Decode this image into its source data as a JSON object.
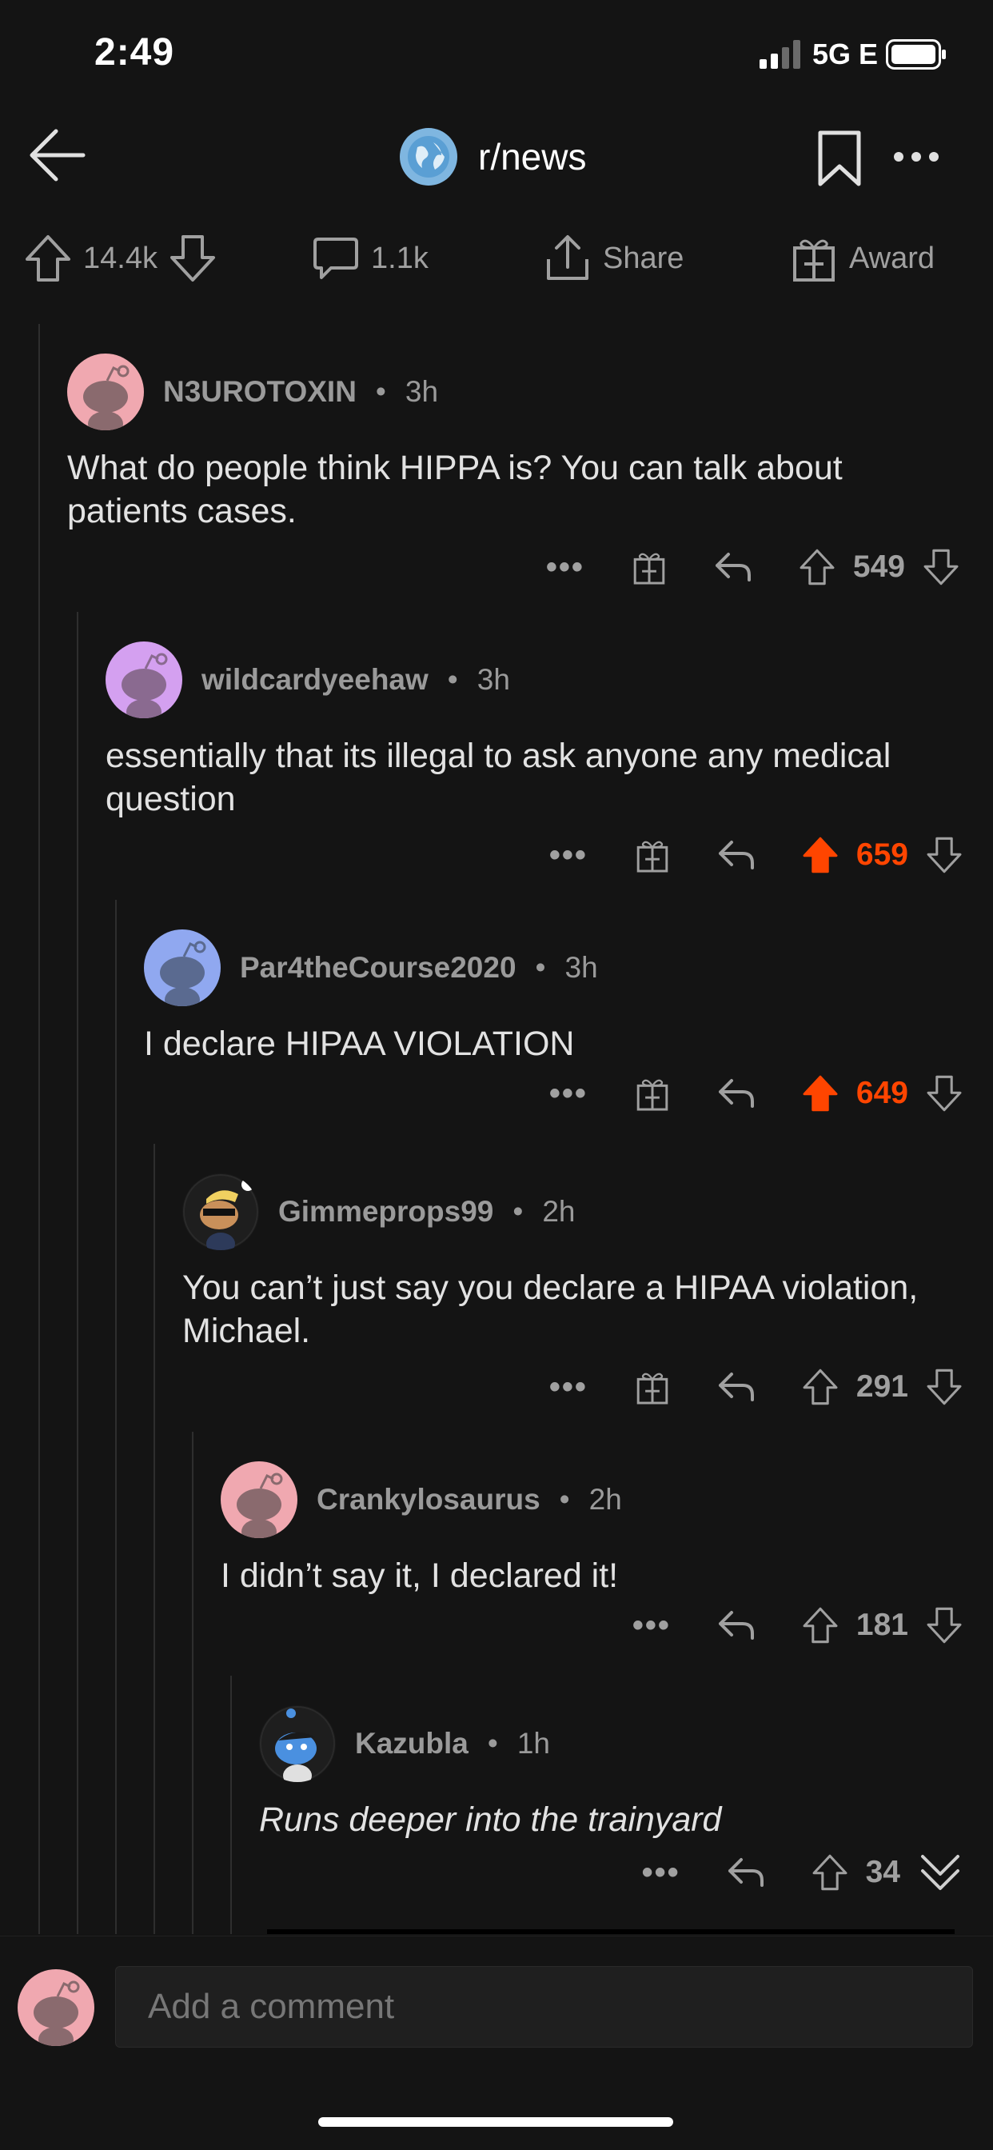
{
  "status_bar": {
    "time": "2:49",
    "network": "5G E"
  },
  "nav": {
    "subreddit": "r/news",
    "back_icon": "back-arrow-icon",
    "bookmark_icon": "bookmark-icon",
    "more_icon": "more-horizontal-icon"
  },
  "post_actions": {
    "upvotes": "14.4k",
    "comments": "1.1k",
    "share": "Share",
    "award": "Award"
  },
  "comments": [
    {
      "username": "N3UROTOXIN",
      "age": "3h",
      "body": "What do people think HIPPA is? You can talk about patients cases.",
      "score": "549",
      "upvoted": false,
      "avatar_color": "#f0a8b0"
    },
    {
      "username": "wildcardyeehaw",
      "age": "3h",
      "body": "essentially that its illegal to ask anyone any medical question",
      "score": "659",
      "upvoted": true,
      "avatar_color": "#d4a0f0"
    },
    {
      "username": "Par4theCourse2020",
      "age": "3h",
      "body": "I declare HIPAA VIOLATION",
      "score": "649",
      "upvoted": true,
      "avatar_color": "#90a8f0"
    },
    {
      "username": "Gimmeprops99",
      "age": "2h",
      "body": "You can’t just say you declare a HIPAA violation, Michael.",
      "score": "291",
      "upvoted": false,
      "avatar_color": "#1a1a1a"
    },
    {
      "username": "Crankylosaurus",
      "age": "2h",
      "body": "I didn’t say it, I declared it!",
      "score": "181",
      "upvoted": false,
      "avatar_color": "#f0a8b0"
    },
    {
      "username": "Kazubla",
      "age": "1h",
      "body": "Runs deeper into the trainyard",
      "score": "34",
      "upvoted": false,
      "avatar_color": "#1a1a1a"
    }
  ],
  "composer": {
    "placeholder": "Add a comment"
  },
  "colors": {
    "upvote": "#ff4500",
    "background": "#141414"
  }
}
